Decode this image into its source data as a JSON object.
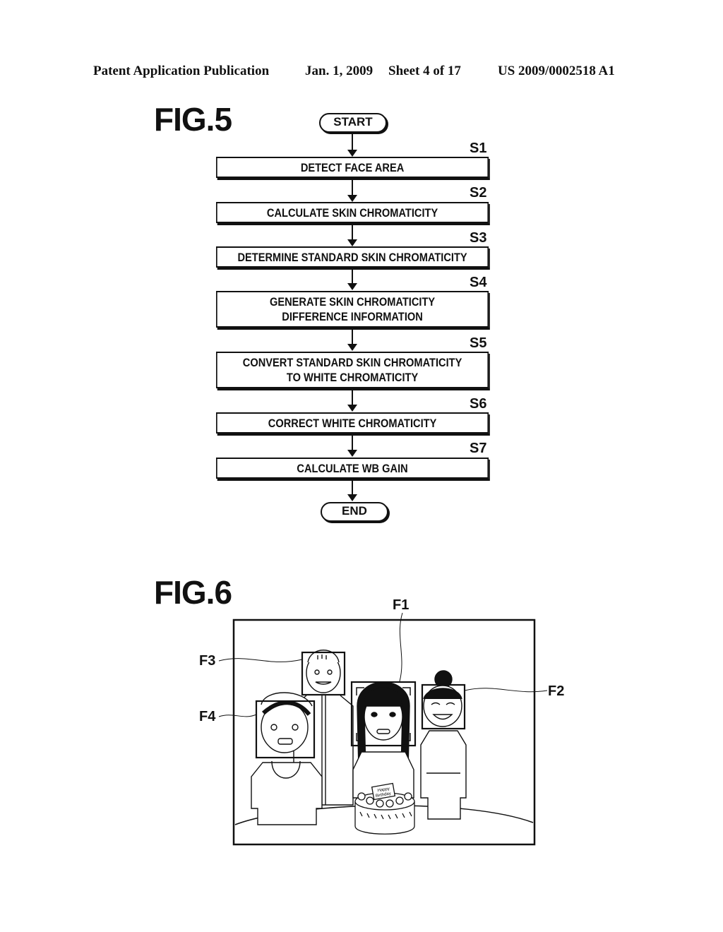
{
  "header": {
    "publication": "Patent Application Publication",
    "date": "Jan. 1, 2009",
    "sheet": "Sheet 4 of 17",
    "number": "US 2009/0002518 A1"
  },
  "fig5": {
    "label": "FIG.5",
    "start": "START",
    "end": "END",
    "steps": [
      {
        "id": "S1",
        "lines": [
          "DETECT FACE AREA"
        ]
      },
      {
        "id": "S2",
        "lines": [
          "CALCULATE SKIN CHROMATICITY"
        ]
      },
      {
        "id": "S3",
        "lines": [
          "DETERMINE STANDARD SKIN CHROMATICITY"
        ]
      },
      {
        "id": "S4",
        "lines": [
          "GENERATE SKIN CHROMATICITY",
          "DIFFERENCE INFORMATION"
        ]
      },
      {
        "id": "S5",
        "lines": [
          "CONVERT STANDARD SKIN CHROMATICITY",
          "TO WHITE CHROMATICITY"
        ]
      },
      {
        "id": "S6",
        "lines": [
          "CORRECT WHITE CHROMATICITY"
        ]
      },
      {
        "id": "S7",
        "lines": [
          "CALCULATE WB GAIN"
        ]
      }
    ]
  },
  "fig6": {
    "label": "FIG.6",
    "face_labels": [
      "F1",
      "F2",
      "F3",
      "F4"
    ],
    "cake_text": [
      "Happy",
      "Birthday"
    ]
  }
}
